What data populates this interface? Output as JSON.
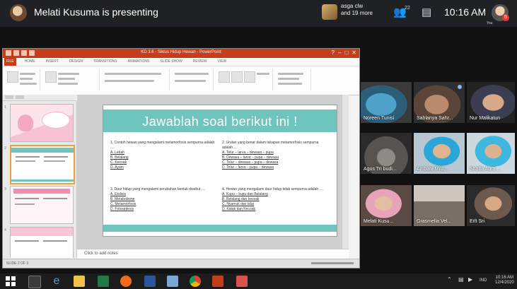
{
  "meet": {
    "presenting_text": "Melati Kusuma is presenting",
    "participant_preview": {
      "line1": "asga clw",
      "line2": "and 19 more"
    },
    "participant_count": "22",
    "time": "10:16 AM",
    "self_label": "You",
    "self_badge": "5"
  },
  "ppt": {
    "window_title": "KD 3.6 - Siklus Hidup Hewan - PowerPoint",
    "ribbon_tabs": [
      "FILE",
      "HOME",
      "INSERT",
      "DESIGN",
      "TRANSITIONS",
      "ANIMATIONS",
      "SLIDE SHOW",
      "REVIEW",
      "VIEW"
    ],
    "notes_placeholder": "Click to add notes",
    "status_text": "SLIDE 2 OF 3",
    "slide": {
      "title": "Jawablah soal berikut ini !",
      "q1": {
        "question": "1. Contoh hewan yang mengalami metamorfosis sempurna adalah ....",
        "options": [
          "A. Lebah",
          "B. Belalang",
          "C. Kecoak",
          "D. Ayam"
        ]
      },
      "q2": {
        "question": "2. Urutan yang benar dalam tahapan metamorfosis sempurna adalah ....",
        "options": [
          "A. Telur – larva – dewasa – pupa",
          "B. Dewasa – larva – pupa – dewasa",
          "C. Telur – dewasa – pupa – dewasa",
          "D. Telur – larva – pupa – dewasa"
        ]
      },
      "q3": {
        "question": "3. Daur hidup yang mengalami perubahan bentuk disebut ....",
        "options": [
          "A. Ekdisis",
          "B. Metabolisme",
          "C. Metamorfosis",
          "D. Fotosintesis"
        ]
      },
      "q4": {
        "question": "4. Hewan yang mengalami daur hidup tidak sempurna adalah ....",
        "options": [
          "A. Kupu – kupu dan Belalang",
          "B. Belalang dan kecoak",
          "C. Nyamuk dan lalat",
          "D. Katak dan Kecoak"
        ]
      }
    },
    "thumb_numbers": [
      "1",
      "2",
      "3",
      "4"
    ]
  },
  "participants": [
    {
      "name": "Noreen Tunisi"
    },
    {
      "name": "Sahlanya Sahr..."
    },
    {
      "name": "Nur Malikatun"
    },
    {
      "name": "Agus Tri budi..."
    },
    {
      "name": "Ambani Mila..."
    },
    {
      "name": "Shaffa Aura ..."
    },
    {
      "name": "Melati Kusu..."
    },
    {
      "name": "Grasmella Vel..."
    },
    {
      "name": "Erlt Sri"
    }
  ],
  "taskbar": {
    "time": "10:16 AM",
    "date": "12/4/2020",
    "lang": "IND"
  },
  "colors": {
    "teal": "#6fc4bd",
    "ppt_red": "#c43e1c",
    "meet_bar": "#202124"
  }
}
